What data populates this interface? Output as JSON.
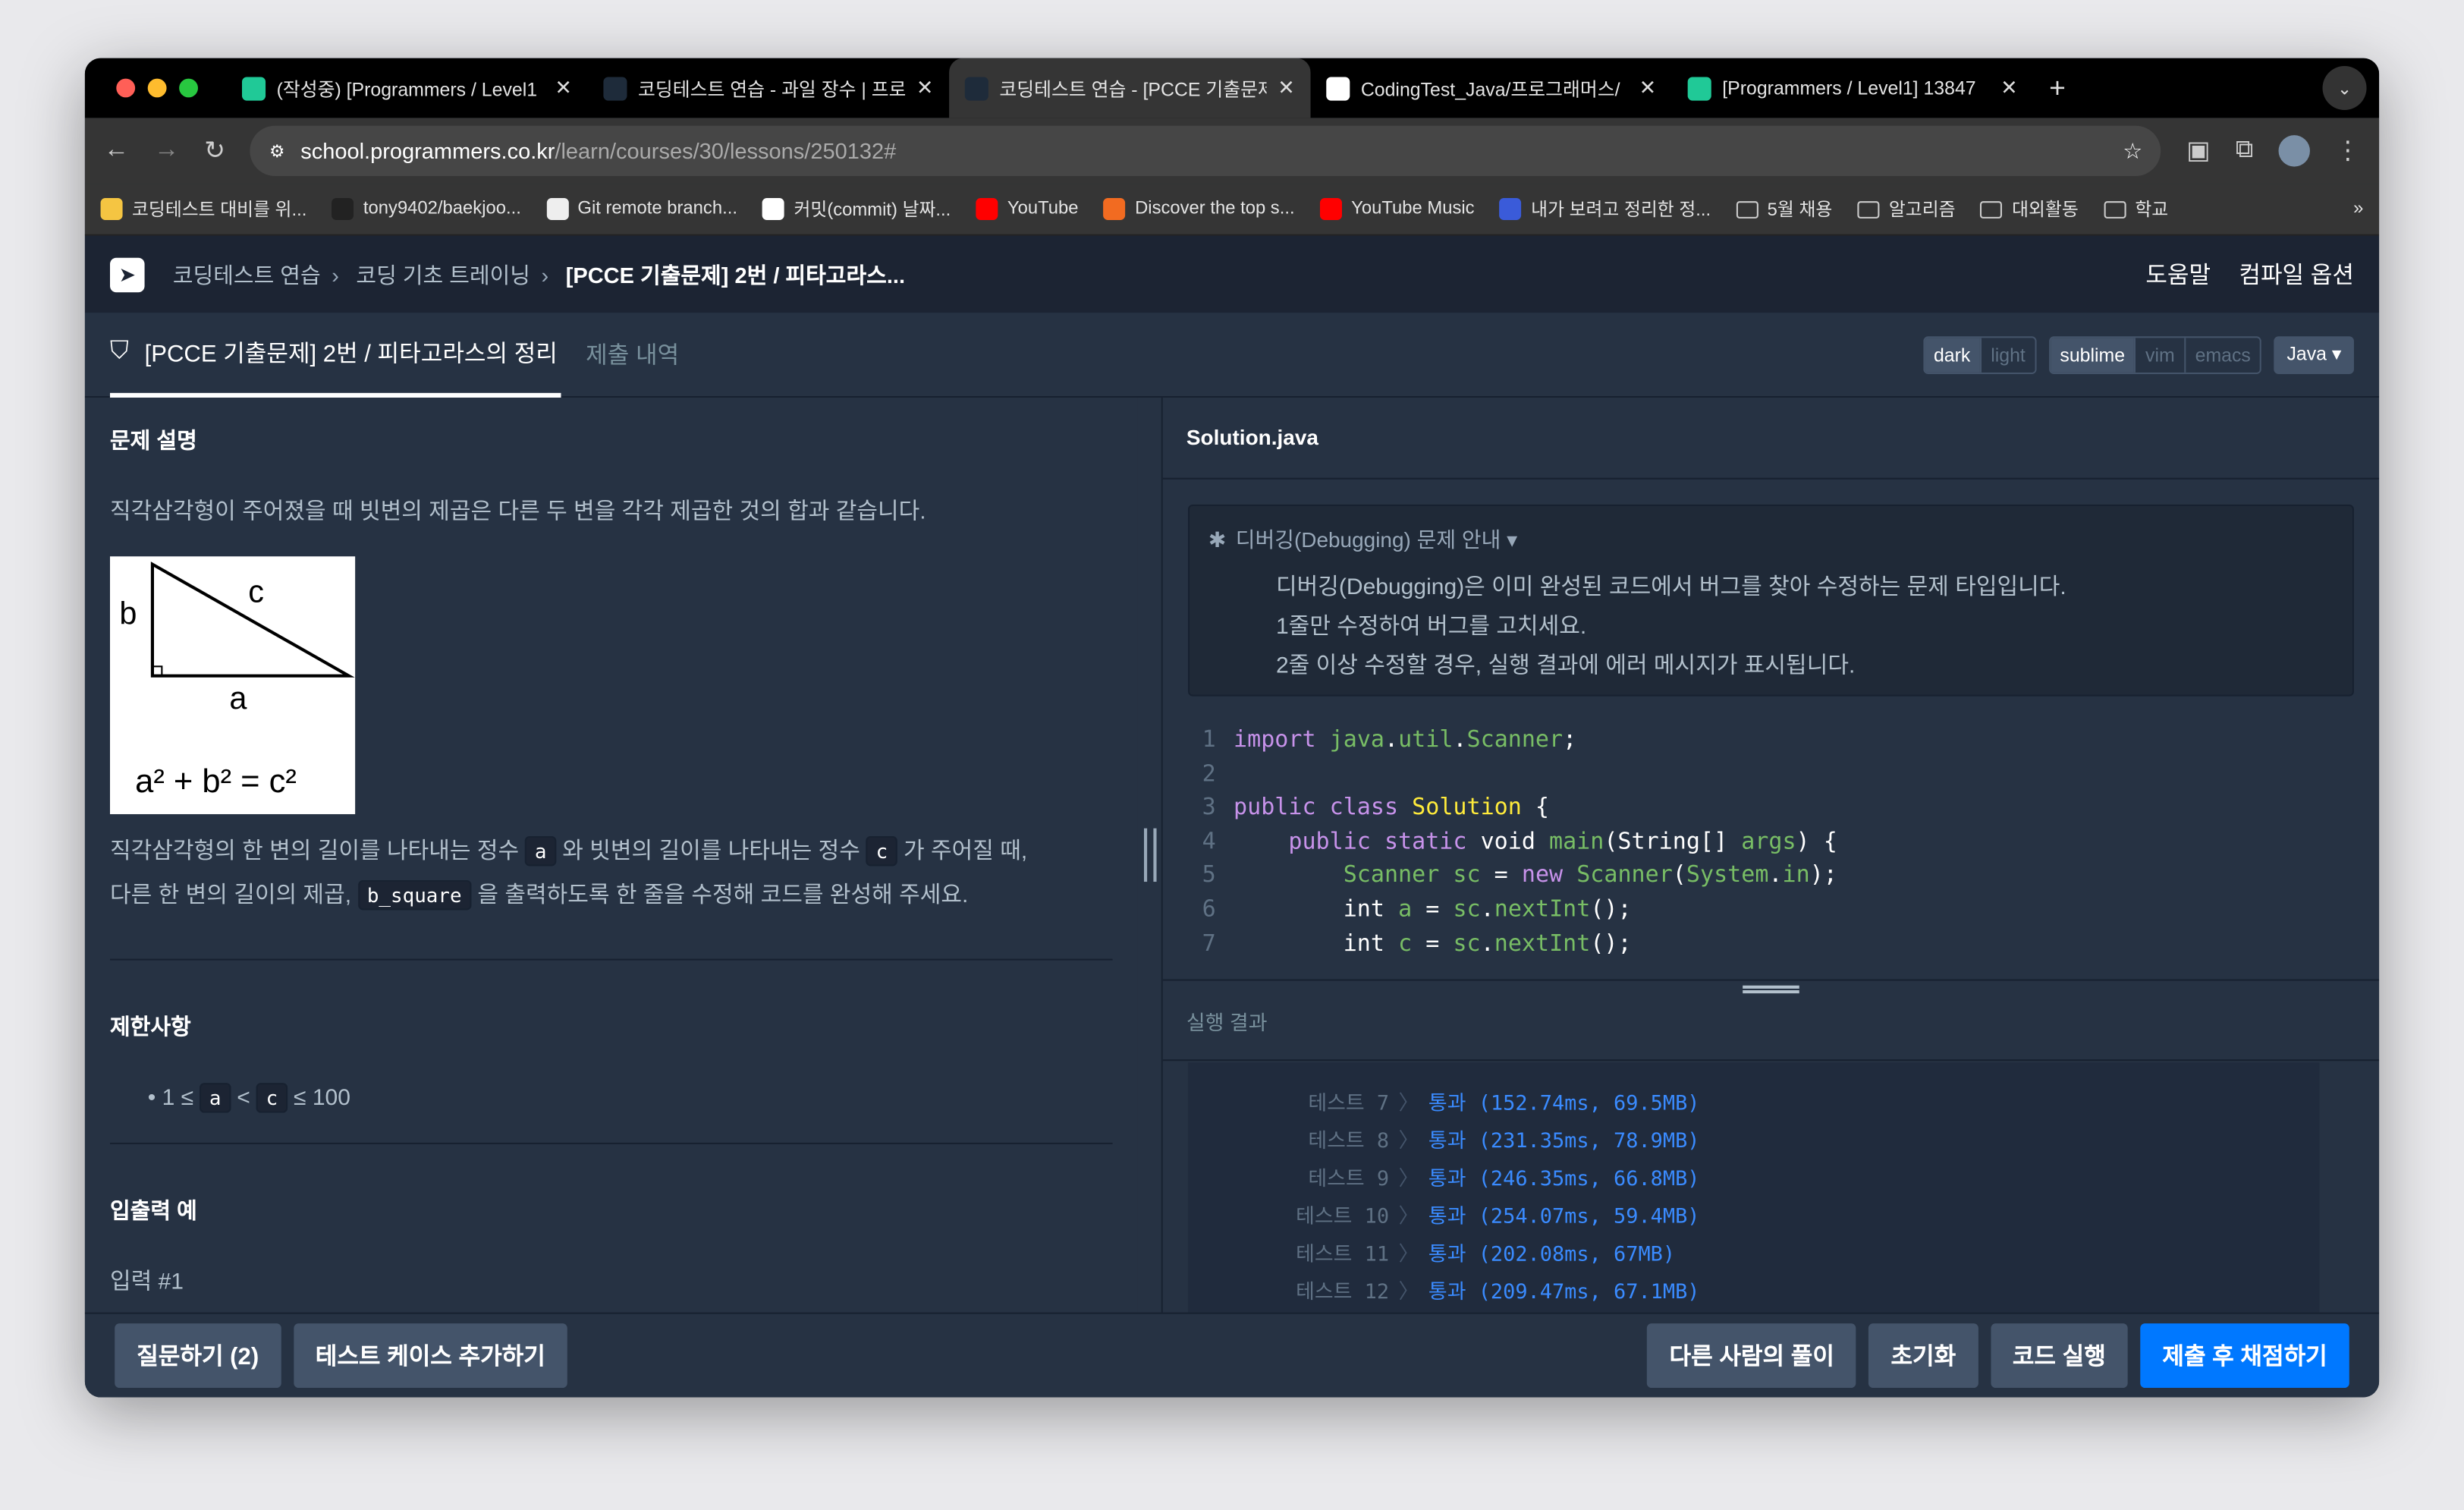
{
  "browser": {
    "tabs": [
      {
        "title": "(작성중) [Programmers / Level1",
        "icon": "velog-icon",
        "color": "#20c997"
      },
      {
        "title": "코딩테스트 연습 - 과일 장수 | 프로",
        "icon": "programmers-icon",
        "color": "#1e2b3a"
      },
      {
        "title": "코딩테스트 연습 - [PCCE 기출문제",
        "icon": "programmers-icon",
        "color": "#1e2b3a",
        "active": true
      },
      {
        "title": "CodingTest_Java/프로그래머스/",
        "icon": "github-icon",
        "color": "#ffffff"
      },
      {
        "title": "[Programmers / Level1] 13847",
        "icon": "velog-icon",
        "color": "#20c997"
      }
    ],
    "url_host": "school.programmers.co.kr",
    "url_path": "/learn/courses/30/lessons/250132#",
    "bookmarks": [
      {
        "label": "코딩테스트 대비를 위...",
        "color": "#f5c542"
      },
      {
        "label": "tony9402/baekjoo...",
        "color": "#222"
      },
      {
        "label": "Git remote branch...",
        "color": "#eee"
      },
      {
        "label": "커밋(commit) 날짜...",
        "color": "#fff"
      },
      {
        "label": "YouTube",
        "color": "#ff0000"
      },
      {
        "label": "Discover the top s...",
        "color": "#f26b21"
      },
      {
        "label": "YouTube Music",
        "color": "#ff0000"
      },
      {
        "label": "내가 보려고 정리한 정...",
        "color": "#3a5bd9"
      },
      {
        "label": "5월 채용",
        "color": "folder"
      },
      {
        "label": "알고리즘",
        "color": "folder"
      },
      {
        "label": "대외활동",
        "color": "folder"
      },
      {
        "label": "학교",
        "color": "folder"
      }
    ],
    "more": "»"
  },
  "header": {
    "crumbs": [
      "코딩테스트 연습",
      "코딩 기초 트레이닝"
    ],
    "current": "[PCCE 기출문제] 2번 / 피타고라스...",
    "help": "도움말",
    "compile": "컴파일 옵션"
  },
  "tabs": {
    "problem": "[PCCE 기출문제] 2번 / 피타고라스의 정리",
    "history": "제출 내역"
  },
  "options": {
    "theme": [
      "dark",
      "light"
    ],
    "keymap": [
      "sublime",
      "vim",
      "emacs"
    ],
    "language": "Java"
  },
  "problem": {
    "section1": "문제 설명",
    "intro": "직각삼각형이 주어졌을 때 빗변의 제곱은 다른 두 변을 각각 제곱한 것의 합과 같습니다.",
    "fig": {
      "b": "b",
      "c": "c",
      "a": "a",
      "formula": "a² + b² = c²"
    },
    "p1a": "직각삼각형의 한 변의 길이를 나타내는 정수 ",
    "c_a": "a",
    "p1b": " 와 빗변의 길이를 나타내는 정수 ",
    "c_c": "c",
    "p1c": " 가 주어질 때,",
    "p2a": "다른 한 변의 길이의 제곱, ",
    "c_b": "b_square",
    "p2b": " 을 출력하도록 한 줄을 수정해 코드를 완성해 주세요.",
    "section2": "제한사항",
    "lim1": "1 ≤ ",
    "lim_a": "a",
    "lim2": " < ",
    "lim_c": "c",
    "lim3": " ≤ 100",
    "section3": "입출력 예",
    "input": "입력 #1"
  },
  "editor": {
    "filename": "Solution.java",
    "info_title": "디버깅(Debugging) 문제 안내",
    "info_lines": [
      "디버깅(Debugging)은 이미 완성된 코드에서 버그를 찾아 수정하는 문제 타입입니다.",
      "1줄만 수정하여 버그를 고치세요.",
      "2줄 이상 수정할 경우, 실행 결과에 에러 메시지가 표시됩니다."
    ],
    "lines": [
      "1",
      "2",
      "3",
      "4",
      "5",
      "6",
      "7"
    ]
  },
  "results": {
    "label": "실행 결과",
    "rows": [
      {
        "t": "테스트 7",
        "v": "통과 (152.74ms, 69.5MB)"
      },
      {
        "t": "테스트 8",
        "v": "통과 (231.35ms, 78.9MB)"
      },
      {
        "t": "테스트 9",
        "v": "통과 (246.35ms, 66.8MB)"
      },
      {
        "t": "테스트 10",
        "v": "통과 (254.07ms, 59.4MB)"
      },
      {
        "t": "테스트 11",
        "v": "통과 (202.08ms, 67MB)"
      },
      {
        "t": "테스트 12",
        "v": "통과 (209.47ms, 67.1MB)"
      }
    ]
  },
  "bottom": {
    "question": "질문하기 (2)",
    "addtc": "테스트 케이스 추가하기",
    "others": "다른 사람의 풀이",
    "reset": "초기화",
    "run": "코드 실행",
    "submit": "제출 후 채점하기"
  }
}
